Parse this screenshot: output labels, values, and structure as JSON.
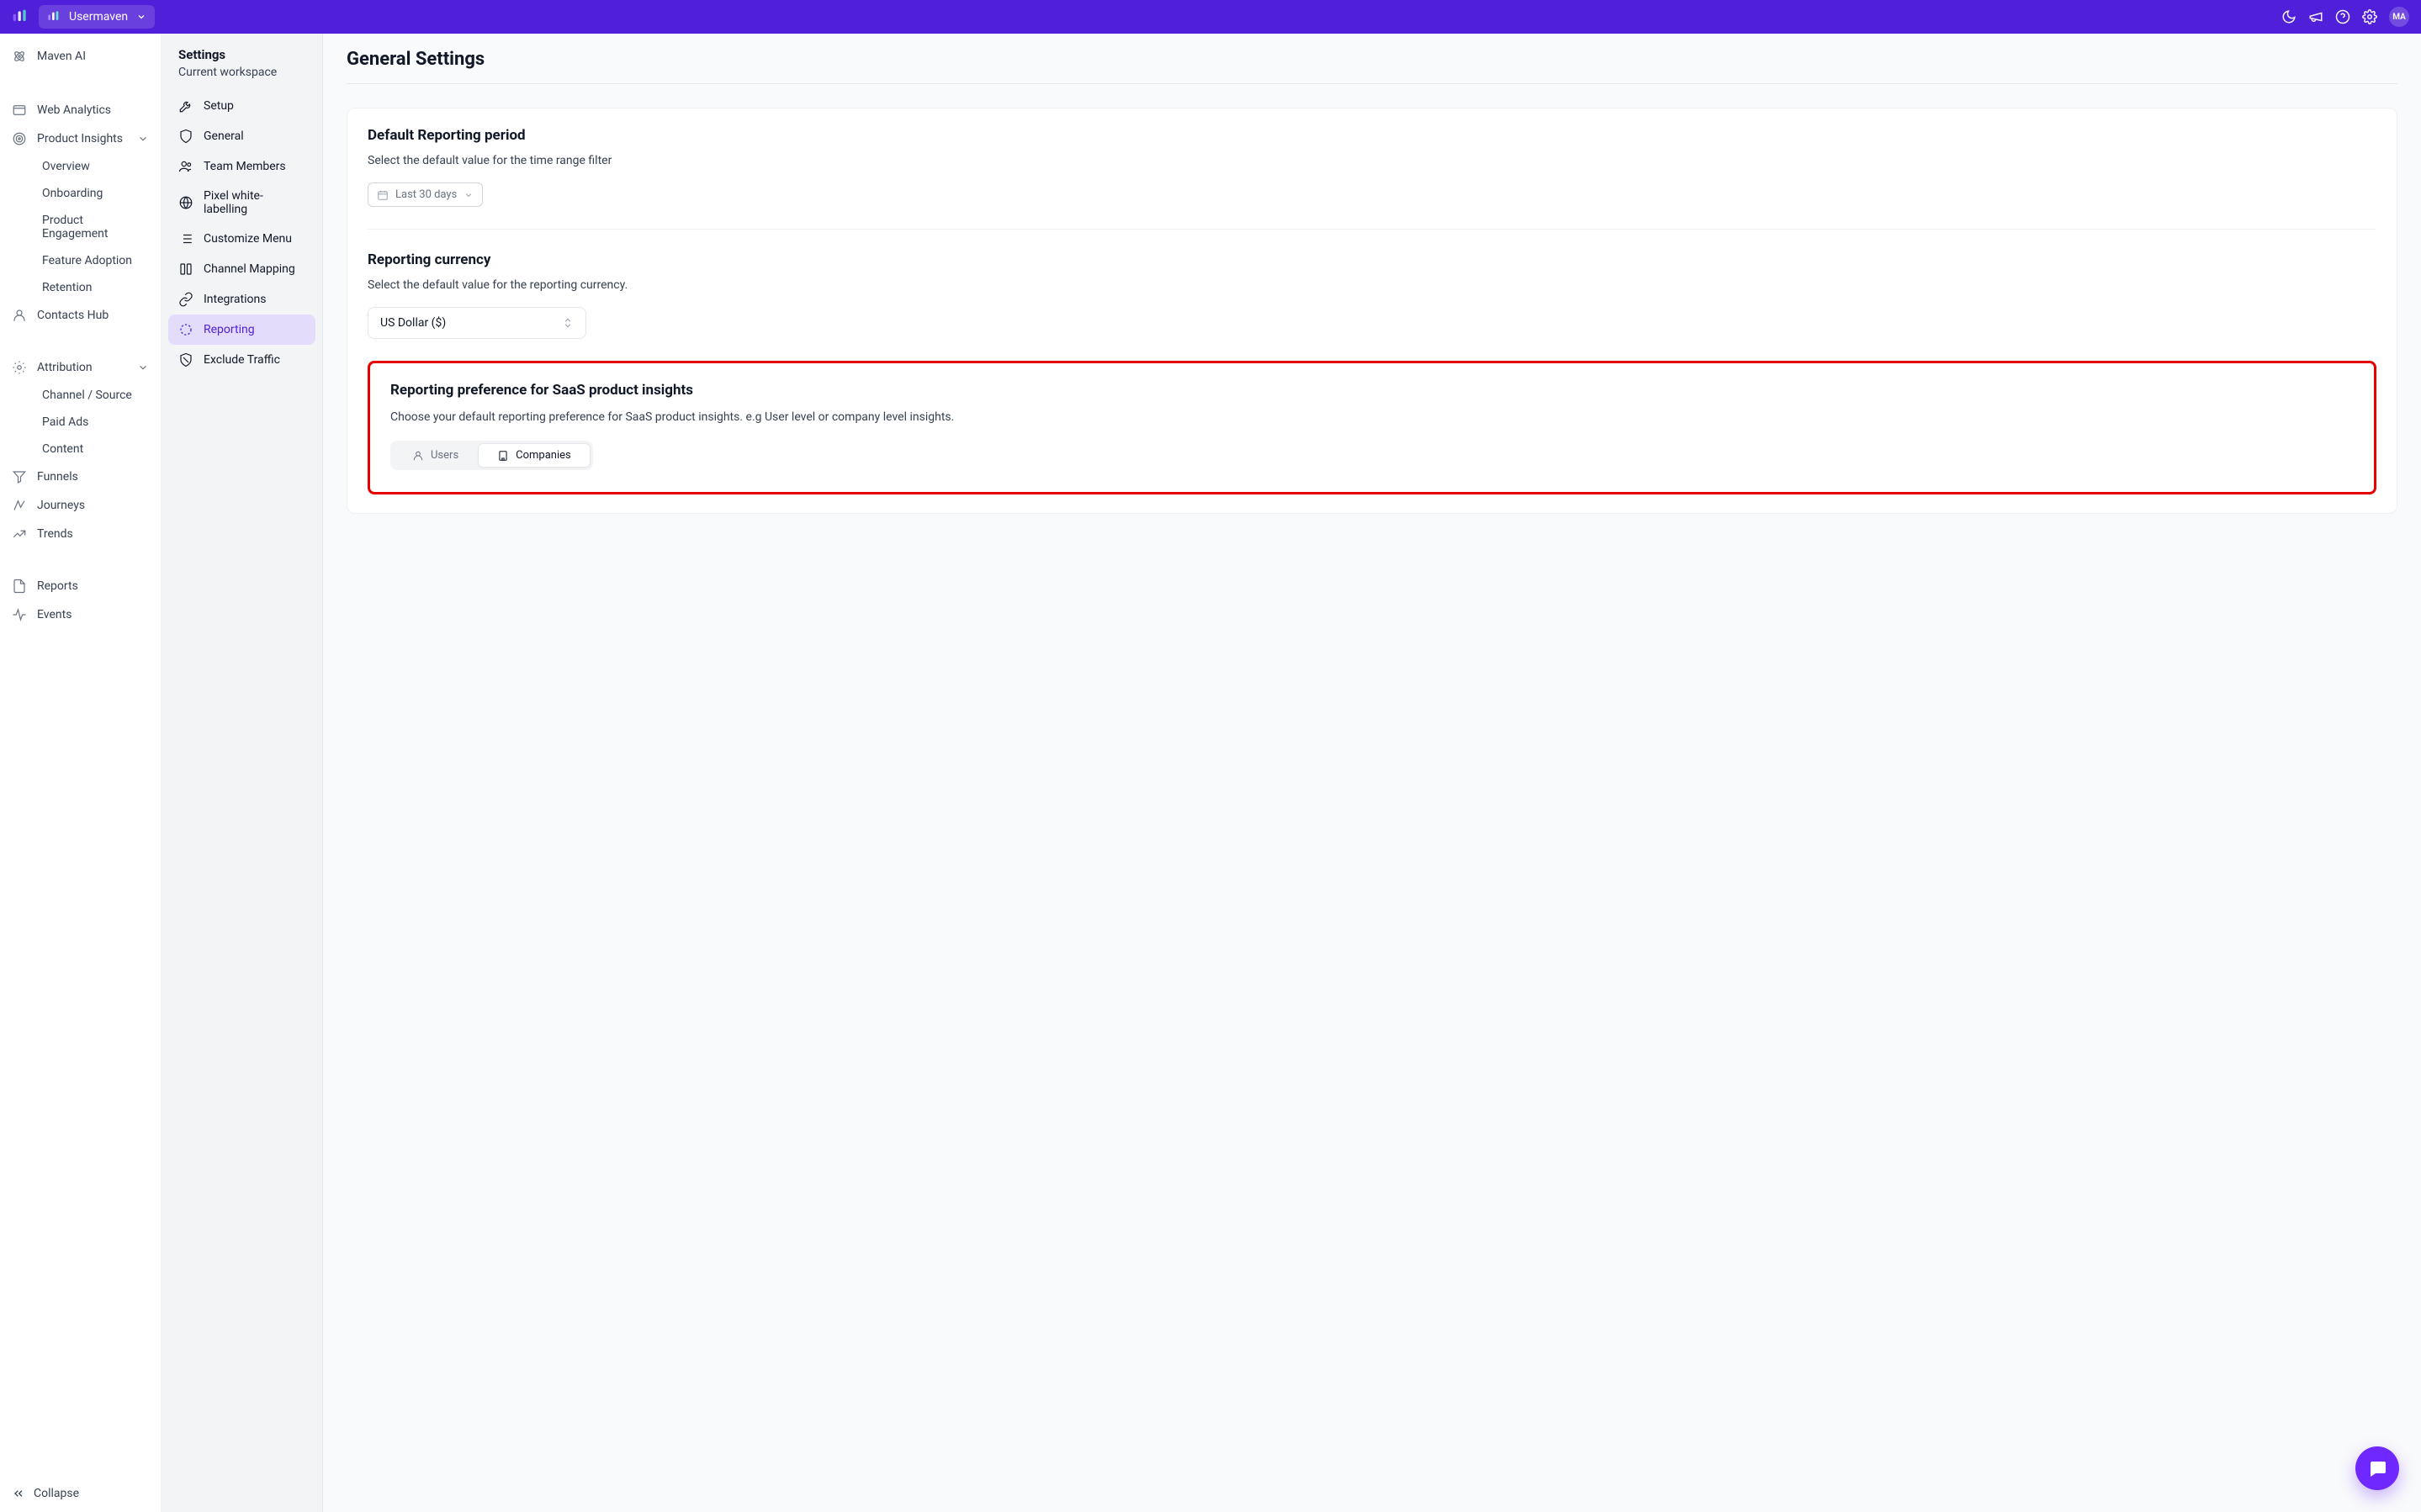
{
  "topbar": {
    "workspace_name": "Usermaven",
    "avatar_initials": "MA"
  },
  "sidebar1": {
    "items": [
      {
        "label": "Maven AI",
        "icon": "atom"
      },
      {
        "label": "Web Analytics",
        "icon": "browser"
      },
      {
        "label": "Product Insights",
        "icon": "target",
        "expanded": true,
        "children": [
          {
            "label": "Overview"
          },
          {
            "label": "Onboarding"
          },
          {
            "label": "Product Engagement"
          },
          {
            "label": "Feature Adoption"
          },
          {
            "label": "Retention"
          }
        ]
      },
      {
        "label": "Contacts Hub",
        "icon": "user"
      },
      {
        "label": "Attribution",
        "icon": "gear",
        "expanded": true,
        "children": [
          {
            "label": "Channel / Source"
          },
          {
            "label": "Paid Ads"
          },
          {
            "label": "Content"
          }
        ]
      },
      {
        "label": "Funnels",
        "icon": "funnel"
      },
      {
        "label": "Journeys",
        "icon": "route"
      },
      {
        "label": "Trends",
        "icon": "chart"
      },
      {
        "label": "Reports",
        "icon": "file"
      },
      {
        "label": "Events",
        "icon": "pulse"
      }
    ],
    "collapse_label": "Collapse"
  },
  "sidebar2": {
    "title": "Settings",
    "subtitle": "Current workspace",
    "items": [
      {
        "label": "Setup",
        "icon": "wrench"
      },
      {
        "label": "General",
        "icon": "shield"
      },
      {
        "label": "Team Members",
        "icon": "people"
      },
      {
        "label": "Pixel white-labelling",
        "icon": "globe"
      },
      {
        "label": "Customize Menu",
        "icon": "list"
      },
      {
        "label": "Channel Mapping",
        "icon": "columns"
      },
      {
        "label": "Integrations",
        "icon": "link"
      },
      {
        "label": "Reporting",
        "icon": "dotted-circle",
        "active": true
      },
      {
        "label": "Exclude Traffic",
        "icon": "shield-off"
      }
    ]
  },
  "main": {
    "title": "General Settings",
    "reporting_period": {
      "heading": "Default Reporting period",
      "desc": "Select the default value for the time range filter",
      "value": "Last 30 days"
    },
    "currency": {
      "heading": "Reporting currency",
      "desc": "Select the default value for the reporting currency.",
      "value": "US Dollar ($)"
    },
    "preference": {
      "heading": "Reporting preference for SaaS product insights",
      "desc": "Choose your default reporting preference for SaaS product insights. e.g User level or company level insights.",
      "options": {
        "users": "Users",
        "companies": "Companies"
      }
    }
  }
}
